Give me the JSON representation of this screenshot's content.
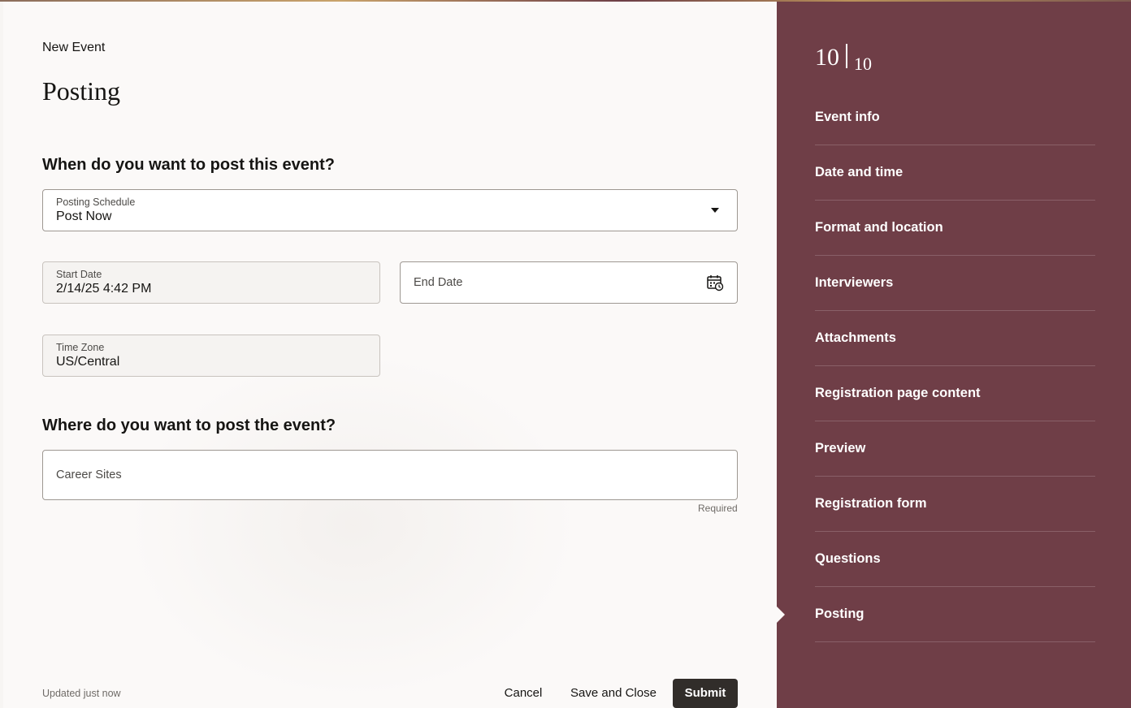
{
  "header": {
    "breadcrumb": "New Event",
    "title": "Posting"
  },
  "when_section": {
    "heading": "When do you want to post this event?",
    "posting_schedule": {
      "label": "Posting Schedule",
      "value": "Post Now"
    },
    "start_date": {
      "label": "Start Date",
      "value": "2/14/25 4:42 PM"
    },
    "end_date": {
      "placeholder": "End Date"
    },
    "time_zone": {
      "label": "Time Zone",
      "value": "US/Central"
    }
  },
  "where_section": {
    "heading": "Where do you want to post the event?",
    "career_sites": {
      "placeholder": "Career Sites",
      "hint": "Required"
    }
  },
  "footer": {
    "status": "Updated just now",
    "cancel_label": "Cancel",
    "save_close_label": "Save and Close",
    "submit_label": "Submit"
  },
  "sidebar": {
    "current_step": "10",
    "total_steps": "10",
    "steps": [
      "Event info",
      "Date and time",
      "Format and location",
      "Interviewers",
      "Attachments",
      "Registration page content",
      "Preview",
      "Registration form",
      "Questions",
      "Posting"
    ]
  },
  "colors": {
    "sidebar_bg": "#6f3e47",
    "submit_bg": "#312d2a",
    "page_bg": "#fbf9f8"
  }
}
